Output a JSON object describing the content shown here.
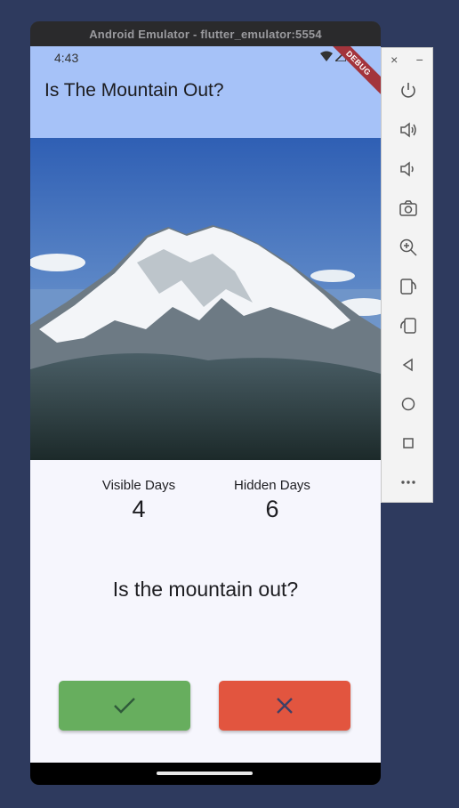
{
  "window": {
    "title": "Android Emulator - flutter_emulator:5554"
  },
  "status_bar": {
    "time": "4:43"
  },
  "app": {
    "title": "Is The Mountain Out?",
    "debug_banner": "DEBUG",
    "visible": {
      "label": "Visible Days",
      "value": "4"
    },
    "hidden": {
      "label": "Hidden Days",
      "value": "6"
    },
    "question": "Is the mountain out?"
  },
  "side_panel": {
    "close": "×",
    "minimize": "−",
    "buttons": [
      "power-icon",
      "volume-up-icon",
      "volume-down-icon",
      "camera-icon",
      "zoom-in-icon",
      "rotate-left-icon",
      "rotate-right-icon",
      "back-icon",
      "home-icon",
      "overview-icon",
      "more-icon"
    ]
  },
  "colors": {
    "appbar": "#a6c2f8",
    "yes": "#67ae5e",
    "no": "#e2553f",
    "background": "#2e3a5e"
  }
}
